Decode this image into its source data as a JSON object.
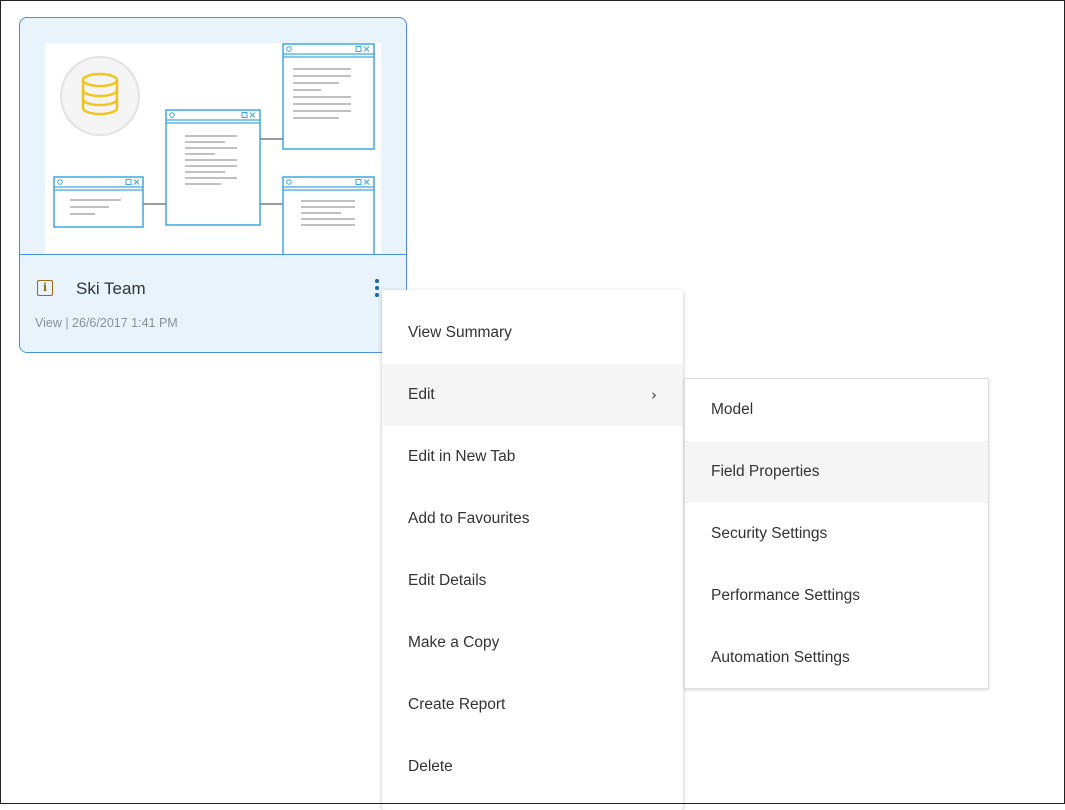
{
  "card": {
    "title": "Ski Team",
    "meta": "View | 26/6/2017 1:41 PM",
    "info_icon_glyph": "i",
    "thumbnail_icon": "database-icon",
    "accent_color": "#4a90e2",
    "background_color": "#e8f3fc"
  },
  "context_menu": {
    "items": [
      {
        "label": "View Summary"
      },
      {
        "label": "Edit",
        "has_submenu": true,
        "chevron": "›"
      },
      {
        "label": "Edit in New Tab"
      },
      {
        "label": "Add to Favourites"
      },
      {
        "label": "Edit Details"
      },
      {
        "label": "Make a Copy"
      },
      {
        "label": "Create Report"
      },
      {
        "label": "Delete"
      }
    ]
  },
  "edit_submenu": {
    "items": [
      {
        "label": "Model"
      },
      {
        "label": "Field Properties"
      },
      {
        "label": "Security Settings"
      },
      {
        "label": "Performance Settings"
      },
      {
        "label": "Automation Settings"
      }
    ]
  }
}
